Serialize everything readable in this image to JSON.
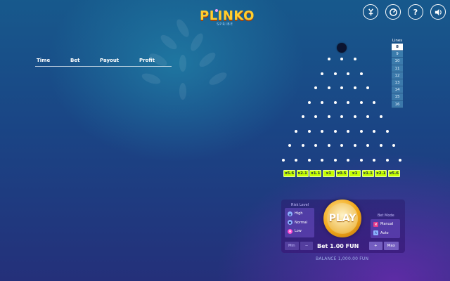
{
  "logo": {
    "title": "PLINKO",
    "subtitle": "SPRIBE"
  },
  "top_icons": [
    {
      "name": "provably-fair-icon"
    },
    {
      "name": "limits-icon"
    },
    {
      "name": "help-icon",
      "glyph": "?"
    },
    {
      "name": "sound-icon"
    }
  ],
  "history": {
    "columns": [
      "Time",
      "Bet",
      "Payout",
      "Profit"
    ]
  },
  "board": {
    "rows": 8,
    "multipliers": [
      "x5.6",
      "x2.1",
      "x1.1",
      "x1",
      "x0.5",
      "x1",
      "x1.1",
      "x2.1",
      "x5.6"
    ],
    "slot_colors": [
      "#c6ff00",
      "#c6ff00",
      "#c6ff00",
      "#c6ff00",
      "#c6ff00",
      "#c6ff00",
      "#c6ff00",
      "#c6ff00",
      "#c6ff00"
    ]
  },
  "lines": {
    "label": "Lines",
    "options": [
      "8",
      "9",
      "10",
      "11",
      "12",
      "13",
      "14",
      "15",
      "16"
    ],
    "selected": "8"
  },
  "risk": {
    "label": "Risk Level",
    "options": [
      "High",
      "Normal",
      "Low"
    ],
    "selected": "Low"
  },
  "bet_mode": {
    "label": "Bet Mode",
    "options": [
      "Manual",
      "Auto"
    ],
    "selected": "Manual"
  },
  "play": {
    "label": "PLAY"
  },
  "bet": {
    "min_label": "Min",
    "minus_label": "−",
    "plus_label": "+",
    "max_label": "Max",
    "text": "Bet 1.00 FUN"
  },
  "balance": {
    "text": "BALANCE 1,000.00 FUN"
  },
  "colors": {
    "accent": "#ffcf2e",
    "slot": "#c6ff00",
    "play": "#f2a81a",
    "risk_selected": "#ff4fd1"
  }
}
